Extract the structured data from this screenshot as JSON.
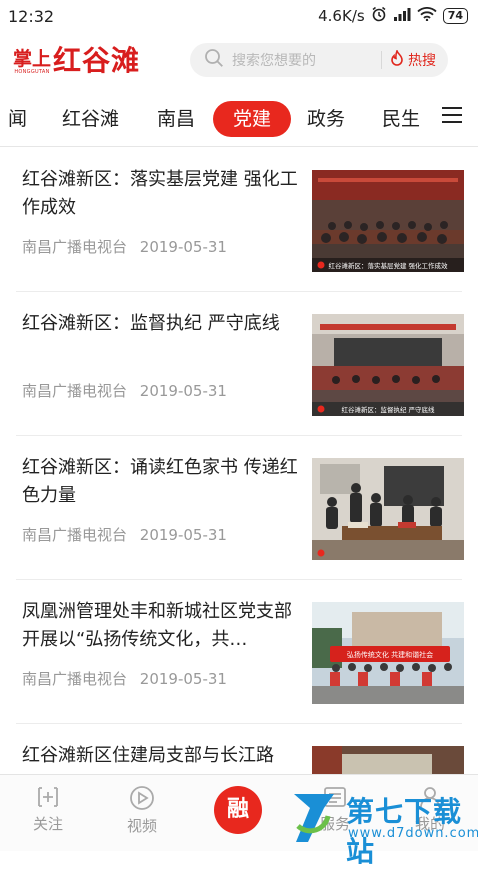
{
  "status": {
    "time": "12:32",
    "speed": "4.6K/s",
    "battery": "74"
  },
  "header": {
    "logo_small": "掌上",
    "logo_en": "HONGGUTAN",
    "logo_main": "红谷滩",
    "search_placeholder": "搜索您想要的",
    "hot_label": "热搜"
  },
  "tabs": [
    {
      "label": "闻"
    },
    {
      "label": "红谷滩"
    },
    {
      "label": "南昌"
    },
    {
      "label": "党建",
      "active": true
    },
    {
      "label": "政务"
    },
    {
      "label": "民生"
    }
  ],
  "news": [
    {
      "title": "红谷滩新区：落实基层党建 强化工作成效",
      "source": "南昌广播电视台",
      "date": "2019-05-31",
      "banner": "红谷滩新区：落实基层党建  强化工作成效"
    },
    {
      "title": "红谷滩新区：监督执纪 严守底线",
      "source": "南昌广播电视台",
      "date": "2019-05-31",
      "banner": "红谷滩新区：监督执纪  严守底线"
    },
    {
      "title": "红谷滩新区：诵读红色家书 传递红色力量",
      "source": "南昌广播电视台",
      "date": "2019-05-31",
      "banner": ""
    },
    {
      "title": "凤凰洲管理处丰和新城社区党支部开展以“弘扬传统文化，共…",
      "source": "南昌广播电视台",
      "date": "2019-05-31",
      "banner": "弘扬传统文化  共建和谐社会"
    },
    {
      "title": "红谷滩新区住建局支部与长江路",
      "source": "",
      "date": "",
      "banner": ""
    }
  ],
  "bottom_nav": [
    {
      "label": "关注"
    },
    {
      "label": "视频"
    },
    {
      "label": "融"
    },
    {
      "label": "服务"
    },
    {
      "label": "我的"
    }
  ],
  "watermark": {
    "text": "第七下载站",
    "url": "www.d7down.com"
  },
  "colors": {
    "brand_red": "#e8281e",
    "watermark_blue": "#1a8fd6"
  }
}
